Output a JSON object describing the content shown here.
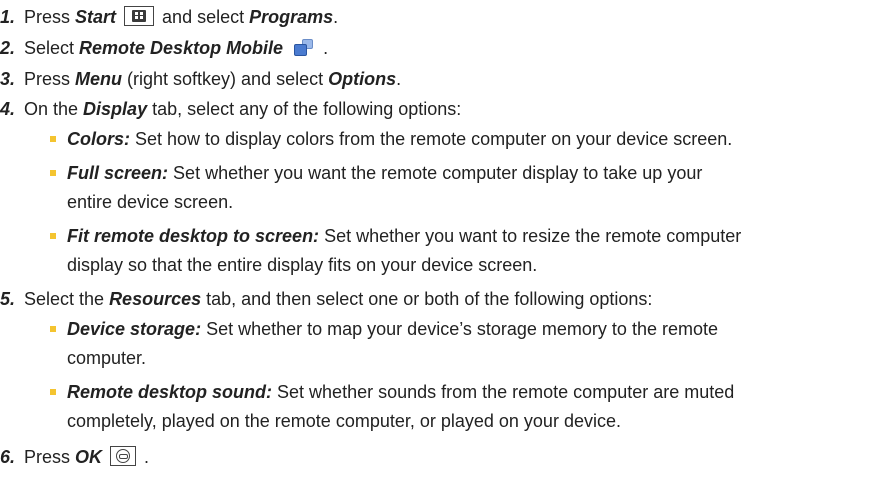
{
  "steps": [
    {
      "num": "1.",
      "parts": [
        "Press ",
        "Start",
        " and select ",
        "Programs",
        "."
      ]
    },
    {
      "num": "2.",
      "parts": [
        "Select ",
        "Remote Desktop Mobile",
        " ."
      ]
    },
    {
      "num": "3.",
      "parts": [
        "Press ",
        "Menu",
        " (right softkey) and select ",
        "Options",
        "."
      ]
    },
    {
      "num": "4.",
      "parts": [
        "On the ",
        "Display",
        " tab, select any of the following options:"
      ],
      "subitems": [
        {
          "term": "Colors:",
          "lines": [
            "Set how to display colors from the remote computer on your device screen."
          ]
        },
        {
          "term": "Full screen:",
          "lines": [
            "Set whether you want the remote computer display to take up your",
            "entire device screen."
          ]
        },
        {
          "term": "Fit remote desktop to screen:",
          "lines": [
            "Set whether you want to resize the remote computer",
            "display so that the entire display fits on your device screen."
          ]
        }
      ]
    },
    {
      "num": "5.",
      "parts": [
        "Select the ",
        "Resources",
        " tab, and then select one or both of the following options:"
      ],
      "subitems": [
        {
          "term": "Device storage:",
          "lines": [
            "Set whether to map your device’s storage memory to the remote",
            "computer."
          ]
        },
        {
          "term": "Remote desktop sound:",
          "lines": [
            "Set whether sounds from the remote computer are muted",
            "completely, played on the remote computer, or played on your device."
          ]
        }
      ]
    },
    {
      "num": "6.",
      "parts": [
        "Press ",
        "OK",
        " ."
      ]
    }
  ],
  "icons": {
    "start_key": "windows-start-key-icon",
    "app": "remote-desktop-mobile-icon",
    "ok_key": "ok-key-icon"
  },
  "colors": {
    "bullet": "#f4c430",
    "text": "#222222"
  }
}
